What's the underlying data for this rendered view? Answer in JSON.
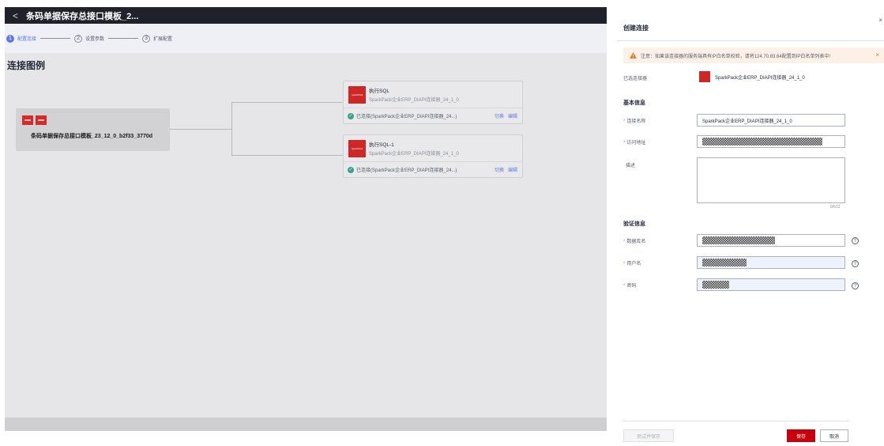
{
  "header": {
    "back_glyph": "<",
    "title": "条码单据保存总接口模板_2..."
  },
  "steps": [
    {
      "num": "1",
      "label": "配置连接"
    },
    {
      "num": "2",
      "label": "设置参数"
    },
    {
      "num": "3",
      "label": "扩展配置"
    }
  ],
  "canvas": {
    "title": "连接图例",
    "source_name": "条码单据保存总接口模板_23_12_0_b2f33_3770d",
    "targets": [
      {
        "title": "执行SQL",
        "connector": "SparkPack企业ERP_DIAPI连接器_24_1_0",
        "status": "已连接(SparkPack企业ERP_DIAPI连接器_24...)",
        "switch_label": "切换",
        "edit_label": "编辑"
      },
      {
        "title": "执行SQL-1",
        "connector": "SparkPack企业ERP_DIAPI连接器_24_1_0",
        "status": "已连接(SparkPack企业ERP_DIAPI连接器_24...)",
        "switch_label": "切换",
        "edit_label": "编辑"
      }
    ]
  },
  "drawer": {
    "title": "创建连接",
    "close_glyph": "×",
    "warning": "注意：如果该连接器的服务端具有IP白名单校验，请将124.70.83.64配置到IP白名单列表中!",
    "selected_label": "已选连接器",
    "selected_value": "SparkPack企业ERP_DIAPI连接器_24_1_0",
    "basic_title": "基本信息",
    "name_label": "连接名称",
    "name_value": "SparkPack企业ERP_DIAPI连接器_24_1_0",
    "url_label": "访问地址",
    "desc_label": "描述",
    "desc_counter": "0/512",
    "auth_title": "验证信息",
    "db_label": "数据库名",
    "user_label": "用户名",
    "pwd_label": "密码",
    "test_button": "测试并保存",
    "save_button": "保存",
    "cancel_button": "取消"
  },
  "colors": {
    "accent": "#5e7ce0",
    "primary_button": "#c7000b",
    "brand_logo": "#cf2626",
    "warning_bg": "#fdf0e6",
    "success": "#3c9e8c"
  },
  "icons": [
    "back-arrow-icon",
    "close-icon",
    "warning-icon",
    "check-circle-icon",
    "help-icon"
  ]
}
